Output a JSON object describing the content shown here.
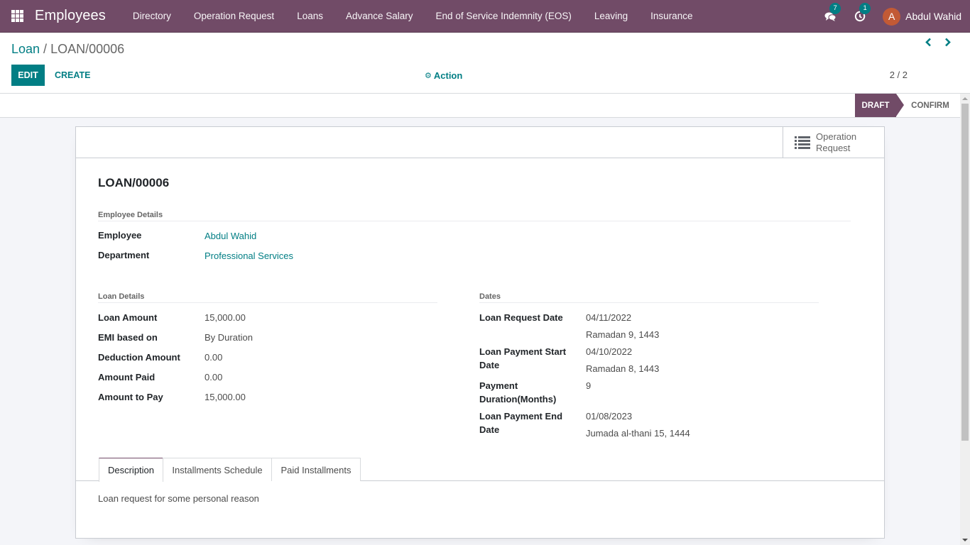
{
  "navbar": {
    "app_title": "Employees",
    "menu": [
      "Directory",
      "Operation Request",
      "Loans",
      "Advance Salary",
      "End of Service Indemnity (EOS)",
      "Leaving",
      "Insurance"
    ],
    "messages_icon": "chat-bubbles-icon",
    "messages_count": "7",
    "activity_icon": "clock-icon",
    "activity_count": "1",
    "user_initial": "A",
    "user_name": "Abdul Wahid",
    "brand_color": "#714b67",
    "avatar_color": "#c25a35"
  },
  "control_panel": {
    "breadcrumb_parent": "Loan",
    "breadcrumb_separator": " / ",
    "breadcrumb_current": "LOAN/00006",
    "edit_label": "EDIT",
    "create_label": "CREATE",
    "action_label": "Action",
    "pager": "2 / 2",
    "accent_color": "#017e84"
  },
  "statusbar": {
    "stages": [
      "DRAFT",
      "CONFIRM"
    ],
    "current": "DRAFT"
  },
  "sheet": {
    "smart_button_label_1": "Operation",
    "smart_button_label_2": "Request",
    "record_name": "LOAN/00006",
    "employee_details": {
      "title": "Employee Details",
      "employee_label": "Employee",
      "employee_value": "Abdul Wahid",
      "department_label": "Department",
      "department_value": "Professional Services"
    },
    "loan_details": {
      "title": "Loan Details",
      "fields": [
        {
          "label": "Loan Amount",
          "value": "15,000.00"
        },
        {
          "label": "EMI based on",
          "value": "By Duration"
        },
        {
          "label": "Deduction Amount",
          "value": "0.00"
        },
        {
          "label": "Amount Paid",
          "value": "0.00"
        },
        {
          "label": "Amount to Pay",
          "value": "15,000.00"
        }
      ]
    },
    "dates": {
      "title": "Dates",
      "request_date_label": "Loan Request Date",
      "request_date": "04/11/2022",
      "request_date_hijri": "Ramadan 9, 1443",
      "start_date_label_1": "Loan Payment Start",
      "start_date_label_2": "Date",
      "start_date": "04/10/2022",
      "start_date_hijri": "Ramadan 8, 1443",
      "duration_label_1": "Payment",
      "duration_label_2": "Duration(Months)",
      "duration": "9",
      "end_date_label_1": "Loan Payment End",
      "end_date_label_2": "Date",
      "end_date": "01/08/2023",
      "end_date_hijri": "Jumada al-thani 15, 1444"
    },
    "tabs": [
      "Description",
      "Installments Schedule",
      "Paid Installments"
    ],
    "active_tab": "Description",
    "description": "Loan request for some personal reason"
  }
}
